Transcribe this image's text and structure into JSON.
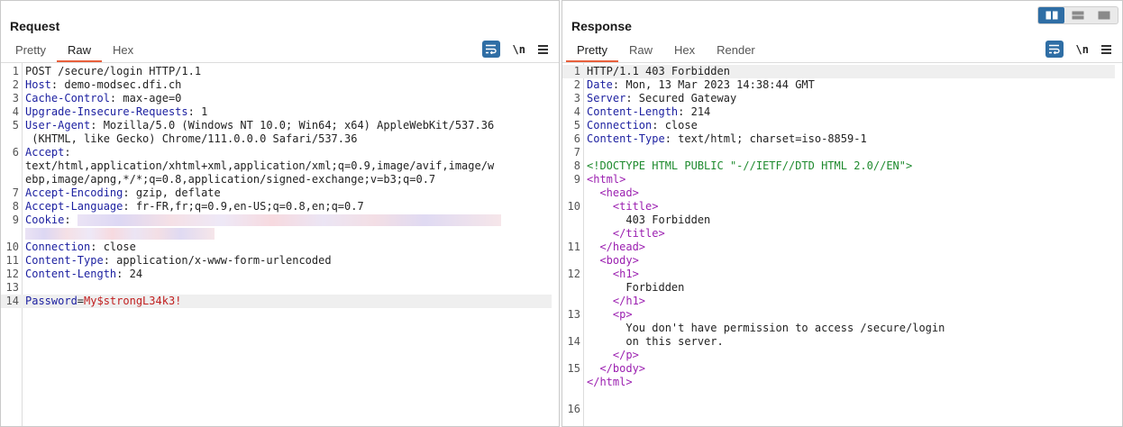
{
  "request": {
    "title": "Request",
    "tabs": [
      {
        "label": "Pretty",
        "active": false
      },
      {
        "label": "Raw",
        "active": true
      },
      {
        "label": "Hex",
        "active": false
      }
    ],
    "newline_label": "\\n",
    "lines": [
      {
        "n": "1",
        "segs": [
          {
            "t": "POST /secure/login HTTP/1.1",
            "c": "plain"
          }
        ]
      },
      {
        "n": "2",
        "segs": [
          {
            "t": "Host",
            "c": "k"
          },
          {
            "t": ": demo-modsec.dfi.ch",
            "c": "v"
          }
        ]
      },
      {
        "n": "3",
        "segs": [
          {
            "t": "Cache-Control",
            "c": "k"
          },
          {
            "t": ": max-age=0",
            "c": "v"
          }
        ]
      },
      {
        "n": "4",
        "segs": [
          {
            "t": "Upgrade-Insecure-Requests",
            "c": "k"
          },
          {
            "t": ": 1",
            "c": "v"
          }
        ]
      },
      {
        "n": "5",
        "segs": [
          {
            "t": "User-Agent",
            "c": "k"
          },
          {
            "t": ": Mozilla/5.0 (Windows NT 10.0; Win64; x64) AppleWebKit/537.36",
            "c": "v"
          }
        ]
      },
      {
        "n": "",
        "segs": [
          {
            "t": " (KHTML, like Gecko) Chrome/111.0.0.0 Safari/537.36",
            "c": "v"
          }
        ]
      },
      {
        "n": "6",
        "segs": [
          {
            "t": "Accept",
            "c": "k"
          },
          {
            "t": ":",
            "c": "v"
          }
        ]
      },
      {
        "n": "",
        "segs": [
          {
            "t": "text/html,application/xhtml+xml,application/xml;q=0.9,image/avif,image/w",
            "c": "v"
          }
        ]
      },
      {
        "n": "",
        "segs": [
          {
            "t": "ebp,image/apng,*/*;q=0.8,application/signed-exchange;v=b3;q=0.7",
            "c": "v"
          }
        ]
      },
      {
        "n": "7",
        "segs": [
          {
            "t": "Accept-Encoding",
            "c": "k"
          },
          {
            "t": ": gzip, deflate",
            "c": "v"
          }
        ]
      },
      {
        "n": "8",
        "segs": [
          {
            "t": "Accept-Language",
            "c": "k"
          },
          {
            "t": ": fr-FR,fr;q=0.9,en-US;q=0.8,en;q=0.7",
            "c": "v"
          }
        ]
      },
      {
        "n": "9",
        "segs": [
          {
            "t": "Cookie",
            "c": "k"
          },
          {
            "t": ": ",
            "c": "v"
          }
        ],
        "blur": 470
      },
      {
        "n": "",
        "segs": [],
        "blur": 210
      },
      {
        "n": "10",
        "segs": [
          {
            "t": "Connection",
            "c": "k"
          },
          {
            "t": ": close",
            "c": "v"
          }
        ]
      },
      {
        "n": "11",
        "segs": [
          {
            "t": "Content-Type",
            "c": "k"
          },
          {
            "t": ": application/x-www-form-urlencoded",
            "c": "v"
          }
        ]
      },
      {
        "n": "12",
        "segs": [
          {
            "t": "Content-Length",
            "c": "k"
          },
          {
            "t": ": 24",
            "c": "v"
          }
        ]
      },
      {
        "n": "13",
        "segs": []
      },
      {
        "n": "14",
        "segs": [
          {
            "t": "Password",
            "c": "k"
          },
          {
            "t": "=",
            "c": "v"
          },
          {
            "t": "My$strongL34k3!",
            "c": "pval"
          }
        ],
        "hl": true
      }
    ]
  },
  "response": {
    "title": "Response",
    "tabs": [
      {
        "label": "Pretty",
        "active": true
      },
      {
        "label": "Raw",
        "active": false
      },
      {
        "label": "Hex",
        "active": false
      },
      {
        "label": "Render",
        "active": false
      }
    ],
    "newline_label": "\\n",
    "lines": [
      {
        "n": "1",
        "segs": [
          {
            "t": "HTTP/1.1 403 Forbidden",
            "c": "plain"
          }
        ],
        "hl": true
      },
      {
        "n": "2",
        "segs": [
          {
            "t": "Date",
            "c": "k"
          },
          {
            "t": ": Mon, 13 Mar 2023 14:38:44 GMT",
            "c": "v"
          }
        ]
      },
      {
        "n": "3",
        "segs": [
          {
            "t": "Server",
            "c": "k"
          },
          {
            "t": ": Secured Gateway",
            "c": "v"
          }
        ]
      },
      {
        "n": "4",
        "segs": [
          {
            "t": "Content-Length",
            "c": "k"
          },
          {
            "t": ": 214",
            "c": "v"
          }
        ]
      },
      {
        "n": "5",
        "segs": [
          {
            "t": "Connection",
            "c": "k"
          },
          {
            "t": ": close",
            "c": "v"
          }
        ]
      },
      {
        "n": "6",
        "segs": [
          {
            "t": "Content-Type",
            "c": "k"
          },
          {
            "t": ": text/html; charset=iso-8859-1",
            "c": "v"
          }
        ]
      },
      {
        "n": "7",
        "segs": []
      },
      {
        "n": "8",
        "segs": [
          {
            "t": "<!DOCTYPE HTML PUBLIC \"-//IETF//DTD HTML 2.0//EN\">",
            "c": "doctype"
          }
        ]
      },
      {
        "n": "9",
        "segs": [
          {
            "t": "<html>",
            "c": "tag"
          }
        ]
      },
      {
        "n": "",
        "segs": [
          {
            "t": "  <head>",
            "c": "tag"
          }
        ]
      },
      {
        "n": "10",
        "segs": [
          {
            "t": "    <title>",
            "c": "tag"
          }
        ]
      },
      {
        "n": "",
        "segs": [
          {
            "t": "      403 Forbidden",
            "c": "plain"
          }
        ]
      },
      {
        "n": "",
        "segs": [
          {
            "t": "    </title>",
            "c": "tag"
          }
        ]
      },
      {
        "n": "11",
        "segs": [
          {
            "t": "  </head>",
            "c": "tag"
          }
        ]
      },
      {
        "n": "",
        "segs": [
          {
            "t": "  <body>",
            "c": "tag"
          }
        ]
      },
      {
        "n": "12",
        "segs": [
          {
            "t": "    <h1>",
            "c": "tag"
          }
        ]
      },
      {
        "n": "",
        "segs": [
          {
            "t": "      Forbidden",
            "c": "plain"
          }
        ]
      },
      {
        "n": "",
        "segs": [
          {
            "t": "    </h1>",
            "c": "tag"
          }
        ]
      },
      {
        "n": "13",
        "segs": [
          {
            "t": "    <p>",
            "c": "tag"
          }
        ]
      },
      {
        "n": "",
        "segs": [
          {
            "t": "      You don't have permission to access /secure/login",
            "c": "plain"
          }
        ]
      },
      {
        "n": "14",
        "segs": [
          {
            "t": "      on this server.",
            "c": "plain"
          }
        ]
      },
      {
        "n": "",
        "segs": [
          {
            "t": "    </p>",
            "c": "tag"
          }
        ]
      },
      {
        "n": "15",
        "segs": [
          {
            "t": "  </body>",
            "c": "tag"
          }
        ]
      },
      {
        "n": "",
        "segs": [
          {
            "t": "</html>",
            "c": "tag"
          }
        ]
      },
      {
        "n": "",
        "segs": []
      },
      {
        "n": "16",
        "segs": []
      }
    ]
  },
  "layout_toggle": {
    "active_index": 0,
    "icons": [
      "split-horizontal-icon",
      "split-vertical-icon",
      "single-pane-icon"
    ]
  },
  "colors": {
    "accent": "#2f6ea5",
    "tab_underline": "#e8603c",
    "header_key": "#1b1fa0",
    "tag": "#9b1fb0",
    "doctype": "#1e8a2e",
    "param_value": "#c12020"
  }
}
